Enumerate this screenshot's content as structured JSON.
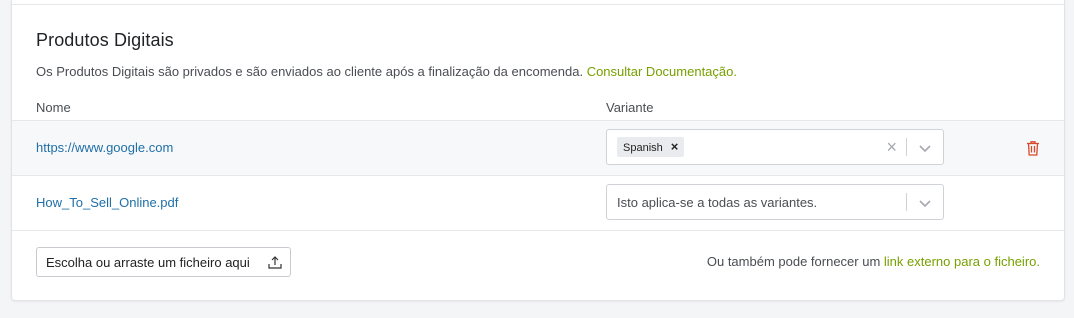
{
  "section": {
    "title": "Produtos Digitais",
    "description": "Os Produtos Digitais são privados e são enviados ao cliente após a finalização da encomenda.",
    "doc_link": "Consultar Documentação."
  },
  "columns": {
    "name": "Nome",
    "variant": "Variante"
  },
  "rows": [
    {
      "name": "https://www.google.com",
      "tag": "Spanish",
      "tag_remove": "×",
      "clear": "×"
    },
    {
      "name": "How_To_Sell_Online.pdf",
      "placeholder": "Isto aplica-se a todas as variantes."
    }
  ],
  "upload": {
    "button_label": "Escolha ou arraste um ficheiro aqui"
  },
  "external": {
    "prefix": "Ou também pode fornecer um",
    "link": "link externo para o ficheiro."
  },
  "colors": {
    "accent_link": "#77a000",
    "file_link": "#1f6fa8",
    "delete": "#d9472b"
  },
  "icons": {
    "delete": "trash-icon",
    "dropdown": "chevron-down-icon",
    "upload": "upload-icon"
  }
}
